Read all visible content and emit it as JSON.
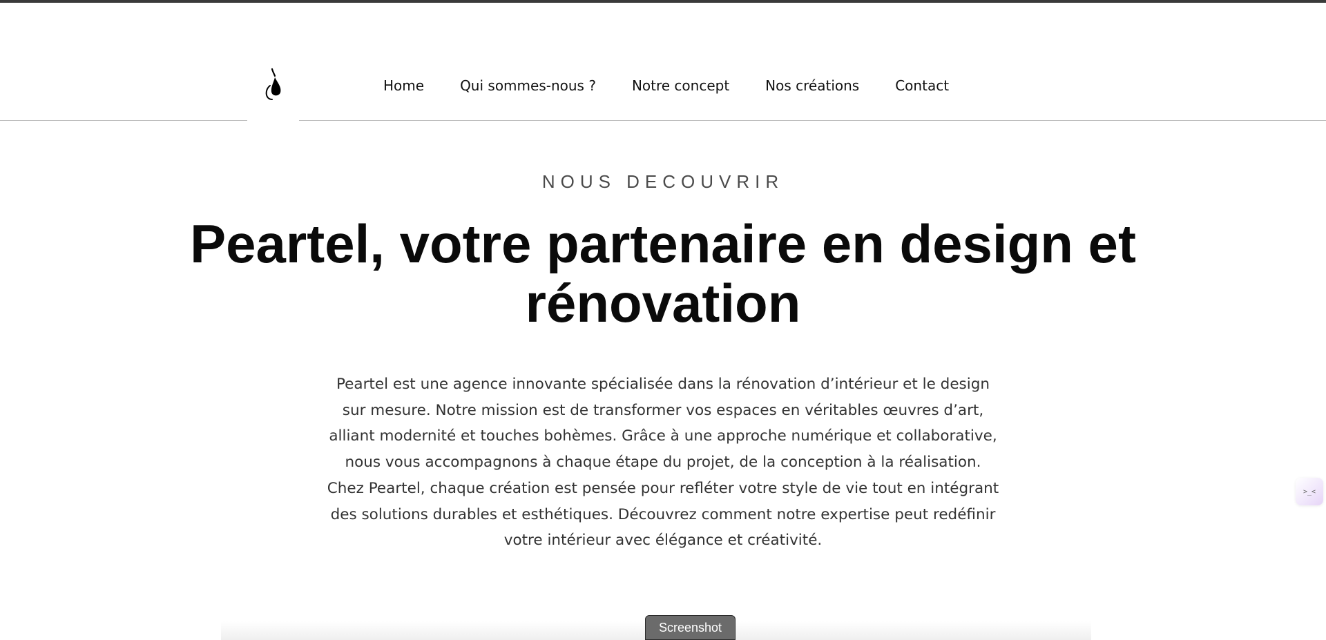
{
  "nav": {
    "items": [
      {
        "label": "Home"
      },
      {
        "label": "Qui sommes-nous ?"
      },
      {
        "label": "Notre concept"
      },
      {
        "label": "Nos créations"
      },
      {
        "label": "Contact"
      }
    ]
  },
  "hero": {
    "eyebrow": "NOUS DECOUVRIR",
    "title": "Peartel, votre partenaire en design et rénovation",
    "body": "Peartel est une agence innovante spécialisée dans la rénovation d’intérieur et le design sur mesure. Notre mission est de transformer vos espaces en véritables œuvres d’art, alliant modernité et touches bohèmes. Grâce à une approche numérique et collaborative, nous vous accompagnons à chaque étape du projet, de la conception à la réalisation. Chez Peartel, chaque création est pensée pour refléter votre style de vie tout en intégrant des solutions durables et esthétiques. Découvrez comment notre expertise peut redéfinir votre intérieur avec élégance et créativité."
  },
  "widget": {
    "glyph": ">_<"
  },
  "screenshot_button": {
    "label": "Screenshot"
  },
  "icons": {
    "logo": "pear-logo-icon"
  }
}
